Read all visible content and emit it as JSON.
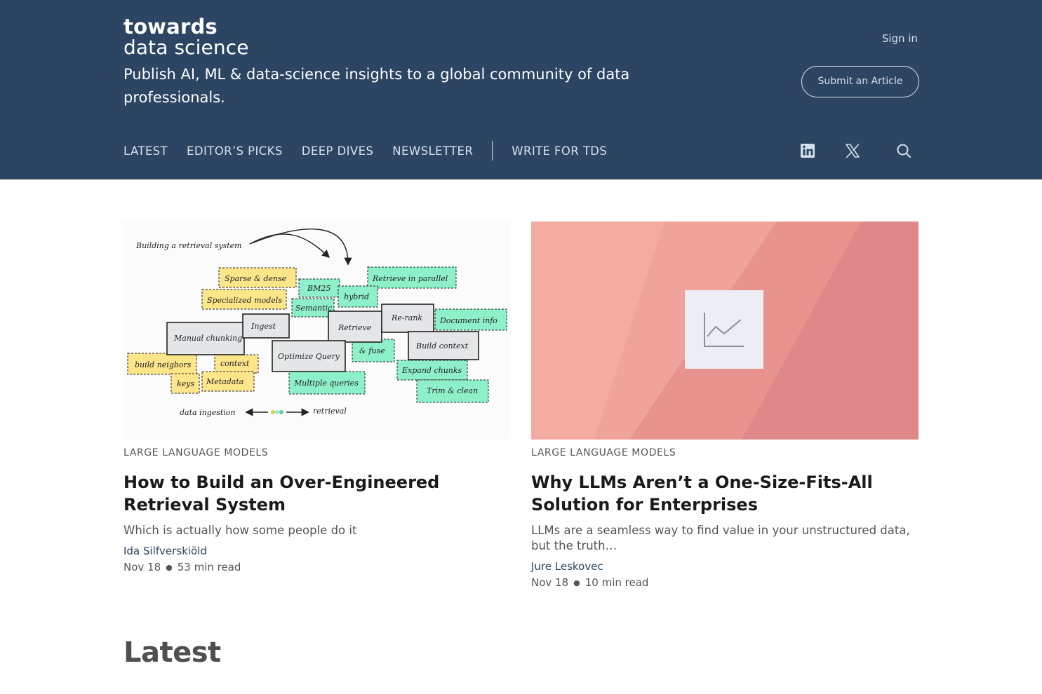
{
  "brand": {
    "logo_line1": "towards",
    "logo_line2": "data science",
    "tagline": "Publish AI, ML & data-science insights to a global community of data professionals."
  },
  "header": {
    "sign_in": "Sign in",
    "submit_article": "Submit an Article"
  },
  "nav": {
    "items": [
      {
        "label": "LATEST"
      },
      {
        "label": "EDITOR’S PICKS"
      },
      {
        "label": "DEEP DIVES"
      },
      {
        "label": "NEWSLETTER"
      }
    ],
    "write_for_tds": "WRITE FOR TDS",
    "icons": [
      "linkedin-icon",
      "x-icon",
      "search-icon"
    ]
  },
  "featured": [
    {
      "category": "LARGE LANGUAGE MODELS",
      "title": "How to Build an Over-Engineered Retrieval System",
      "subtitle": "Which is actually how some people do it",
      "author": "Ida Silfverskiöld",
      "date": "Nov 18",
      "read_time": "53 min read",
      "image_texts": {
        "heading": "Building a retrieval system",
        "sparse_dense": "Sparse & dense",
        "bm25": "BM25",
        "retrieve_parallel": "Retrieve in parallel",
        "specialized": "Specialized models",
        "hybrid": "hybrid",
        "semantic": "Semantic",
        "ingest": "Ingest",
        "retrieve": "Retrieve",
        "rerank": "Re-rank",
        "document_info": "Document info",
        "manual_chunking": "Manual chunking",
        "optimize_query": "Optimize Query",
        "fuse": "& fuse",
        "build_context": "Build context",
        "build_neighbors": "build neigbors",
        "context": "context",
        "expand_chunks": "Expand chunks",
        "keys": "keys",
        "metadata": "Metadata",
        "multiple_queries": "Multiple queries",
        "trim_clean": "Trim & clean",
        "data_ingestion": "data ingestion",
        "retrieval": "retrieval"
      }
    },
    {
      "category": "LARGE LANGUAGE MODELS",
      "title": "Why LLMs Aren’t a One-Size-Fits-All Solution for Enterprises",
      "subtitle": "LLMs are a seamless way to find value in your unstructured data, but the truth…",
      "author": "Jure Leskovec",
      "date": "Nov 18",
      "read_time": "10 min read"
    }
  ],
  "sections": {
    "latest_heading": "Latest"
  },
  "colors": {
    "header_bg": "#2b4563",
    "header_text": "#ffffff",
    "nav_text": "#d6e0ea",
    "author_link": "#2b4563",
    "yellow_tag": "#fde58a",
    "green_tag": "#8ef0c9",
    "grey_box": "#e4e6e8",
    "pink_bg": "#ec9a94"
  }
}
